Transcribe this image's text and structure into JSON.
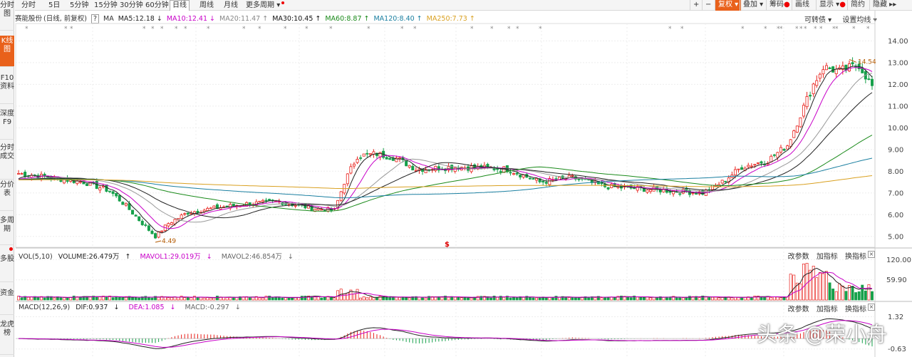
{
  "sidebar": {
    "items": [
      {
        "label": "分时图",
        "active": false
      },
      {
        "label": "K线图",
        "active": true
      },
      {
        "label": "F10资料",
        "active": false
      },
      {
        "label": "深度F9",
        "active": false
      },
      {
        "label": "分时成交",
        "active": false
      },
      {
        "label": "分价表",
        "active": false
      },
      {
        "label": "多周期",
        "active": false
      },
      {
        "label": "多股",
        "active": false
      },
      {
        "label": "资金",
        "active": false
      },
      {
        "label": "龙虎榜",
        "active": false
      }
    ]
  },
  "toolbar": {
    "periods": [
      "分时",
      "5日",
      "5分钟",
      "15分钟",
      "30分钟",
      "60分钟",
      "日线",
      "周线",
      "月线",
      "更多周期"
    ],
    "active_period": "日线",
    "right_buttons": [
      "复权",
      "叠加",
      "筹码",
      "画线",
      "显示",
      "简约",
      "隐藏"
    ],
    "plus": "+",
    "minus": "−"
  },
  "stock_header": {
    "name": "赛能股份",
    "mode": "(日线, 前复权)",
    "help": "?",
    "ma_label": "MA",
    "ma_items": [
      {
        "text": "MA5:12.18",
        "arrow": "↓",
        "color": "#222222"
      },
      {
        "text": "MA10:12.41",
        "arrow": "↓",
        "color": "#c800c8"
      },
      {
        "text": "MA20:11.47",
        "arrow": "↑",
        "color": "#888888"
      },
      {
        "text": "MA30:10.45",
        "arrow": "↑",
        "color": "#111111"
      },
      {
        "text": "MA60:8.87",
        "arrow": "↑",
        "color": "#1a8a1a"
      },
      {
        "text": "MA120:8.40",
        "arrow": "↑",
        "color": "#1a7fa0"
      },
      {
        "text": "MA250:7.73",
        "arrow": "↑",
        "color": "#d9a020"
      }
    ],
    "transfer_label": "可转债",
    "settings_label": "设置均线"
  },
  "colors": {
    "up": "#e8211c",
    "down": "#16a04a",
    "accent": "#e9611b"
  },
  "vol_header": {
    "title": "VOL(5,10)",
    "volume": "VOLUME:26.479万",
    "mavol1": "MAVOL1:29.019万",
    "mavol2": "MAVOL2:46.854万",
    "arrows": [
      "↑",
      "↓",
      "↓"
    ]
  },
  "macd_header": {
    "title": "MACD(12,26,9)",
    "dif": "DIF:0.937",
    "dea": "DEA:1.085",
    "macd": "MACD:-0.297",
    "arrows": [
      "↓",
      "↓",
      "↓"
    ]
  },
  "sub_tools": [
    "改参数",
    "加指标",
    "换指标"
  ],
  "close_label": "×",
  "watermark": "头条 @荣小舟",
  "chart_data": {
    "type": "candlestick",
    "ylim": [
      4.5,
      14.8
    ],
    "y_ticks": [
      "14.00",
      "13.00",
      "12.00",
      "11.00",
      "10.00",
      "9.00",
      "8.00",
      "7.00",
      "6.00",
      "5.00"
    ],
    "y_tick_values": [
      14,
      13,
      12,
      11,
      10,
      9,
      8,
      7,
      6,
      5
    ],
    "annotations": [
      {
        "text": "4.49",
        "type": "min_low"
      },
      {
        "text": "14.54",
        "type": "max_high"
      },
      {
        "text": "$",
        "type": "marker"
      }
    ],
    "close_path": [
      [
        0,
        7.9
      ],
      [
        10,
        7.7
      ],
      [
        20,
        7.5
      ],
      [
        28,
        7.1
      ],
      [
        33,
        6.4
      ],
      [
        38,
        5.6
      ],
      [
        42,
        5.0
      ],
      [
        46,
        5.6
      ],
      [
        52,
        6.1
      ],
      [
        60,
        6.3
      ],
      [
        70,
        6.5
      ],
      [
        80,
        6.6
      ],
      [
        90,
        6.3
      ],
      [
        97,
        6.2
      ],
      [
        100,
        7.5
      ],
      [
        104,
        8.7
      ],
      [
        110,
        8.8
      ],
      [
        116,
        8.6
      ],
      [
        122,
        8.1
      ],
      [
        135,
        8.2
      ],
      [
        150,
        8.1
      ],
      [
        160,
        7.5
      ],
      [
        170,
        7.7
      ],
      [
        180,
        7.3
      ],
      [
        200,
        7.1
      ],
      [
        210,
        7.0
      ],
      [
        216,
        7.5
      ],
      [
        222,
        8.2
      ],
      [
        230,
        8.5
      ],
      [
        236,
        9.2
      ],
      [
        240,
        10.6
      ],
      [
        244,
        12.0
      ],
      [
        247,
        12.8
      ],
      [
        252,
        12.6
      ],
      [
        258,
        12.9
      ],
      [
        262,
        11.9
      ]
    ],
    "n_bars": 263,
    "moving_averages": [
      {
        "name": "MA5",
        "value": 12.18
      },
      {
        "name": "MA10",
        "value": 12.41
      },
      {
        "name": "MA20",
        "value": 11.47
      },
      {
        "name": "MA30",
        "value": 10.45
      },
      {
        "name": "MA60",
        "value": 8.87
      },
      {
        "name": "MA120",
        "value": 8.4
      },
      {
        "name": "MA250",
        "value": 7.73
      }
    ],
    "volume": {
      "ticks": [
        "120.00",
        "59.90"
      ],
      "tick_values": [
        120,
        59.9
      ],
      "last": 26.479,
      "mavol1": 29.019,
      "mavol2": 46.854
    },
    "macd": {
      "ticks": [
        "1.32",
        "-0.63"
      ],
      "tick_values": [
        1.32,
        -0.63
      ],
      "dif": 0.937,
      "dea": 1.085,
      "macd": -0.297
    }
  }
}
